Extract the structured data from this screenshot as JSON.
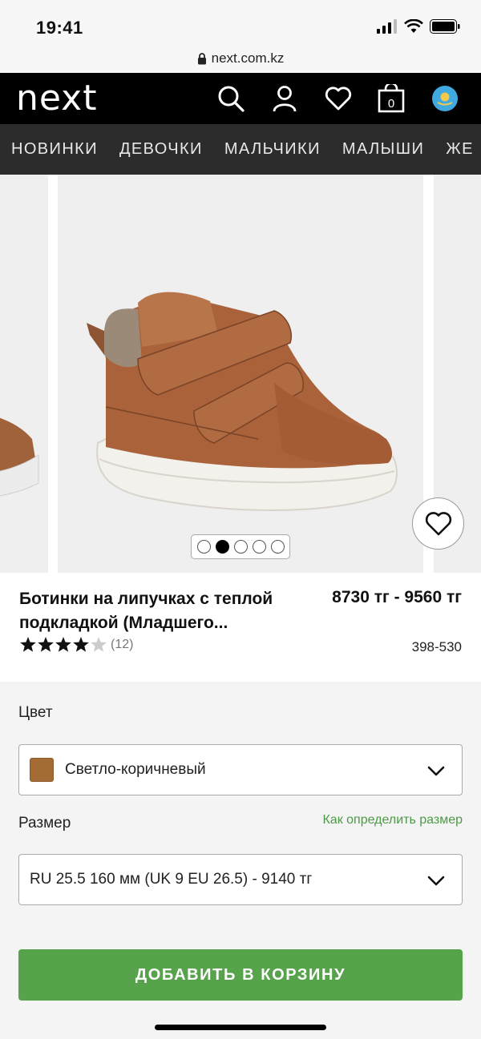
{
  "status_bar": {
    "time": "19:41"
  },
  "browser": {
    "url": "next.com.kz"
  },
  "header": {
    "logo": "next",
    "bag_count": "0"
  },
  "nav": {
    "items": [
      "НОВИНКИ",
      "ДЕВОЧКИ",
      "МАЛЬЧИКИ",
      "МАЛЫШИ",
      "ЖЕ"
    ]
  },
  "product": {
    "title": "Ботинки на липучках с теплой подкладкой  (Младшего...",
    "price": "8730 тг - 9560 тг",
    "sku": "398-530",
    "rating": {
      "stars": 4.5,
      "reviews": "(12)"
    },
    "carousel": {
      "slides": 5,
      "active_index": 1
    }
  },
  "options": {
    "color_label": "Цвет",
    "color_value": "Светло-коричневый",
    "color_swatch": "#a46c35",
    "size_label": "Размер",
    "size_guide_link": "Как определить размер",
    "size_value": "RU 25.5 160 мм (UK 9 EU 26.5) - 9140 тг"
  },
  "actions": {
    "add_to_cart": "ДОБАВИТЬ В КОРЗИНУ"
  },
  "colors": {
    "accent_green": "#56a34b",
    "link_green": "#4c9a46"
  }
}
